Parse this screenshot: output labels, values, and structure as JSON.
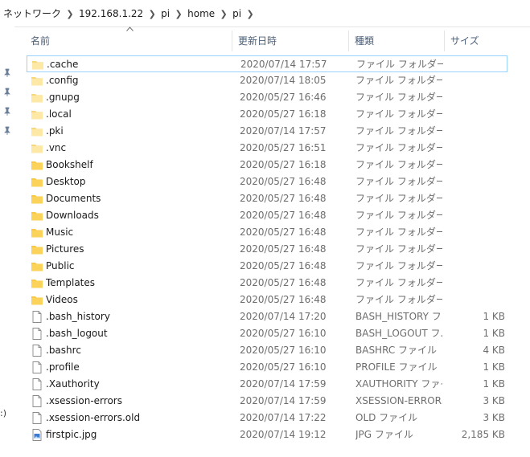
{
  "breadcrumb": {
    "segments": [
      "ネットワーク",
      "192.168.1.22",
      "pi",
      "home",
      "pi"
    ]
  },
  "columns": {
    "name": "名前",
    "date": "更新日時",
    "type": "種類",
    "size": "サイズ"
  },
  "colors": {
    "folder": "#f8c846",
    "folder_light": "#fde9a5",
    "selection_border": "#99d1ff",
    "header_text": "#4c607a"
  },
  "files": [
    {
      "name": ".cache",
      "date": "2020/07/14 17:57",
      "type": "ファイル フォルダー",
      "size": "",
      "icon": "folder-light-icon"
    },
    {
      "name": ".config",
      "date": "2020/07/14 18:05",
      "type": "ファイル フォルダー",
      "size": "",
      "icon": "folder-light-icon"
    },
    {
      "name": ".gnupg",
      "date": "2020/05/27 16:46",
      "type": "ファイル フォルダー",
      "size": "",
      "icon": "folder-light-icon"
    },
    {
      "name": ".local",
      "date": "2020/05/27 16:18",
      "type": "ファイル フォルダー",
      "size": "",
      "icon": "folder-light-icon"
    },
    {
      "name": ".pki",
      "date": "2020/07/14 17:57",
      "type": "ファイル フォルダー",
      "size": "",
      "icon": "folder-light-icon"
    },
    {
      "name": ".vnc",
      "date": "2020/05/27 16:51",
      "type": "ファイル フォルダー",
      "size": "",
      "icon": "folder-light-icon"
    },
    {
      "name": "Bookshelf",
      "date": "2020/05/27 16:18",
      "type": "ファイル フォルダー",
      "size": "",
      "icon": "folder-icon"
    },
    {
      "name": "Desktop",
      "date": "2020/05/27 16:48",
      "type": "ファイル フォルダー",
      "size": "",
      "icon": "folder-icon"
    },
    {
      "name": "Documents",
      "date": "2020/05/27 16:48",
      "type": "ファイル フォルダー",
      "size": "",
      "icon": "folder-icon"
    },
    {
      "name": "Downloads",
      "date": "2020/05/27 16:48",
      "type": "ファイル フォルダー",
      "size": "",
      "icon": "folder-icon"
    },
    {
      "name": "Music",
      "date": "2020/05/27 16:48",
      "type": "ファイル フォルダー",
      "size": "",
      "icon": "folder-icon"
    },
    {
      "name": "Pictures",
      "date": "2020/05/27 16:48",
      "type": "ファイル フォルダー",
      "size": "",
      "icon": "folder-icon"
    },
    {
      "name": "Public",
      "date": "2020/05/27 16:48",
      "type": "ファイル フォルダー",
      "size": "",
      "icon": "folder-icon"
    },
    {
      "name": "Templates",
      "date": "2020/05/27 16:48",
      "type": "ファイル フォルダー",
      "size": "",
      "icon": "folder-icon"
    },
    {
      "name": "Videos",
      "date": "2020/05/27 16:48",
      "type": "ファイル フォルダー",
      "size": "",
      "icon": "folder-icon"
    },
    {
      "name": ".bash_history",
      "date": "2020/07/14 17:20",
      "type": "BASH_HISTORY フ...",
      "size": "1 KB",
      "icon": "file-icon"
    },
    {
      "name": ".bash_logout",
      "date": "2020/05/27 16:10",
      "type": "BASH_LOGOUT フ...",
      "size": "1 KB",
      "icon": "file-icon"
    },
    {
      "name": ".bashrc",
      "date": "2020/05/27 16:10",
      "type": "BASHRC ファイル",
      "size": "4 KB",
      "icon": "file-icon"
    },
    {
      "name": ".profile",
      "date": "2020/05/27 16:10",
      "type": "PROFILE ファイル",
      "size": "1 KB",
      "icon": "file-icon"
    },
    {
      "name": ".Xauthority",
      "date": "2020/07/14 17:59",
      "type": "XAUTHORITY ファイ...",
      "size": "1 KB",
      "icon": "file-icon"
    },
    {
      "name": ".xsession-errors",
      "date": "2020/07/14 17:59",
      "type": "XSESSION-ERROR...",
      "size": "3 KB",
      "icon": "file-icon"
    },
    {
      "name": ".xsession-errors.old",
      "date": "2020/07/14 17:22",
      "type": "OLD ファイル",
      "size": "3 KB",
      "icon": "file-icon"
    },
    {
      "name": "firstpic.jpg",
      "date": "2020/07/14 19:12",
      "type": "JPG ファイル",
      "size": "2,185 KB",
      "icon": "image-file-icon"
    }
  ],
  "left_edge_text": ":)"
}
